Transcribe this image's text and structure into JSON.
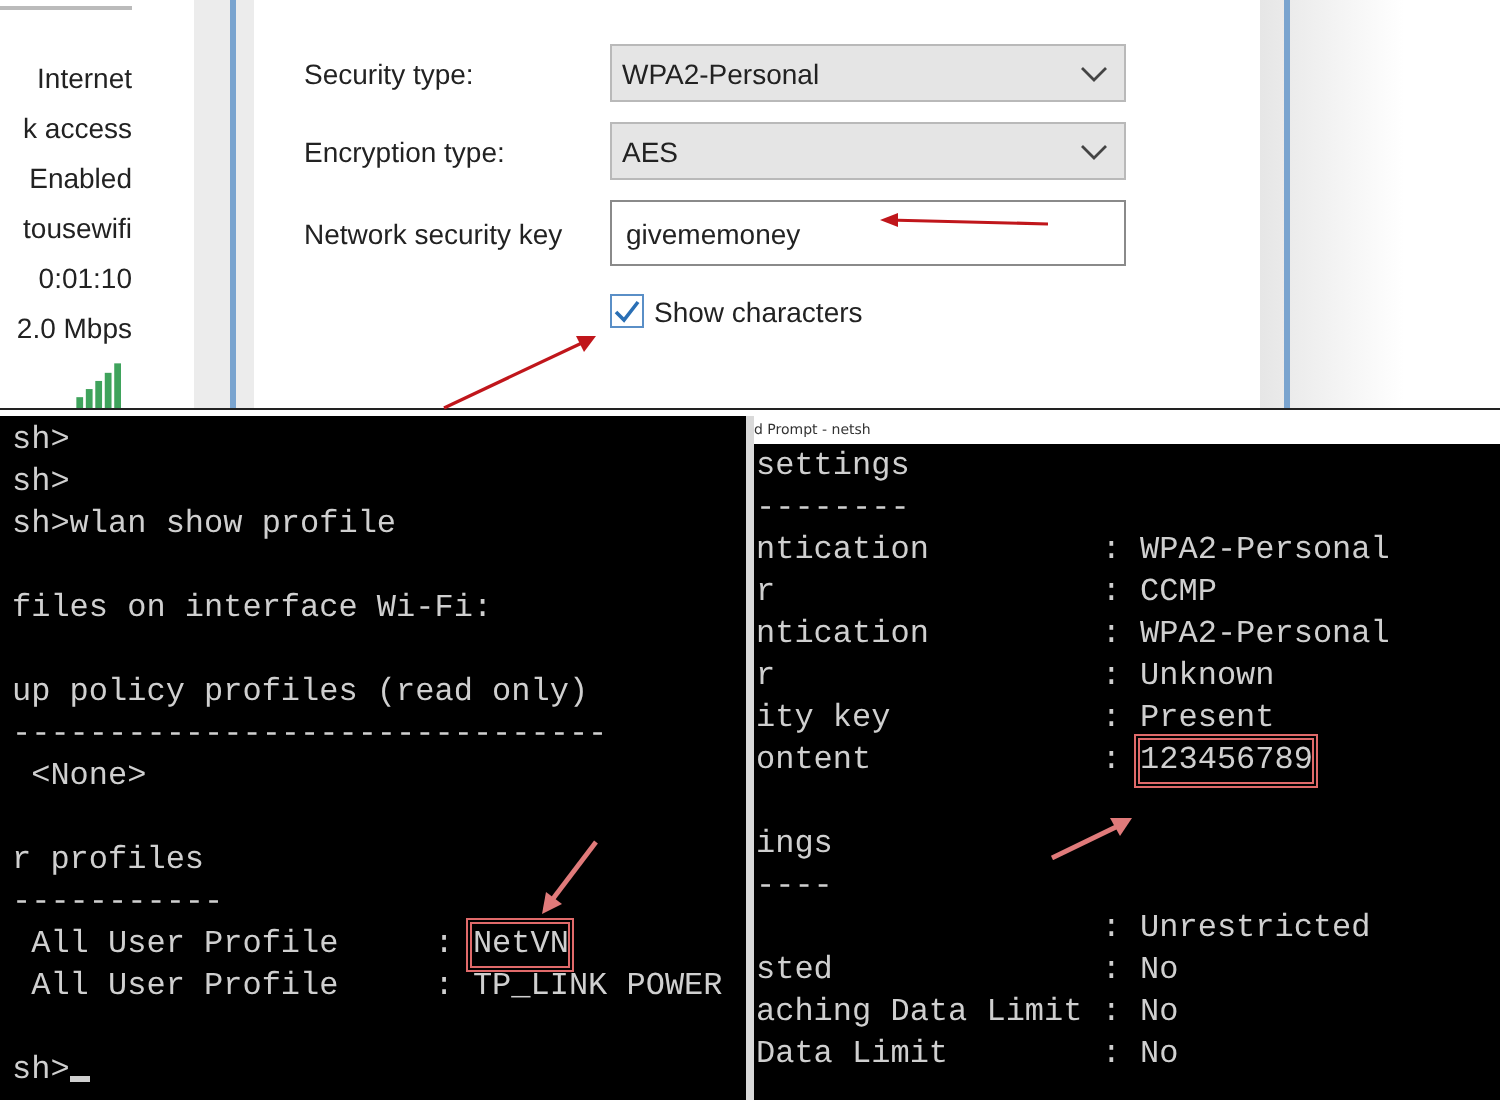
{
  "network_status": {
    "lines": [
      "Internet",
      "k access",
      "Enabled",
      "tousewifi",
      "0:01:10",
      "2.0 Mbps"
    ]
  },
  "security_dialog": {
    "fields": [
      {
        "kind": "dropdown",
        "label": "Security type:",
        "value": "WPA2-Personal"
      },
      {
        "kind": "dropdown",
        "label": "Encryption type:",
        "value": "AES"
      },
      {
        "kind": "text",
        "label": "Network security key",
        "value": "givememoney"
      }
    ],
    "show_characters": {
      "label": "Show characters",
      "checked": true
    }
  },
  "terminals": [
    {
      "lines": [
        {
          "kind": "plain",
          "text": "sh>"
        },
        {
          "kind": "plain",
          "text": "sh>"
        },
        {
          "kind": "plain",
          "text": "sh>wlan show profile"
        },
        {
          "kind": "blank"
        },
        {
          "kind": "plain",
          "text": "files on interface Wi-Fi:"
        },
        {
          "kind": "blank"
        },
        {
          "kind": "plain",
          "text": "up policy profiles (read only)"
        },
        {
          "kind": "plain",
          "text": "-------------------------------"
        },
        {
          "kind": "plain",
          "text": " <None>"
        },
        {
          "kind": "blank"
        },
        {
          "kind": "plain",
          "text": "r profiles"
        },
        {
          "kind": "plain",
          "text": "-----------"
        },
        {
          "kind": "boxed",
          "text": " All User Profile     : ",
          "value": "NetVN"
        },
        {
          "kind": "plain",
          "text": " All User Profile     : TP_LINK POWER"
        },
        {
          "kind": "blank"
        },
        {
          "kind": "plain",
          "text": "sh>"
        }
      ],
      "cursor": true
    },
    {
      "title": "d Prompt - netsh",
      "lines": [
        {
          "kind": "plain",
          "text": "settings"
        },
        {
          "kind": "plain",
          "text": "--------"
        },
        {
          "kind": "plain",
          "text": "ntication         : WPA2-Personal"
        },
        {
          "kind": "plain",
          "text": "r                 : CCMP"
        },
        {
          "kind": "plain",
          "text": "ntication         : WPA2-Personal"
        },
        {
          "kind": "plain",
          "text": "r                 : Unknown"
        },
        {
          "kind": "plain",
          "text": "ity key           : Present"
        },
        {
          "kind": "boxed",
          "text": "ontent            : ",
          "value": "123456789"
        },
        {
          "kind": "blank"
        },
        {
          "kind": "plain",
          "text": "ings"
        },
        {
          "kind": "plain",
          "text": "----"
        },
        {
          "kind": "plain",
          "text": "                  : Unrestricted"
        },
        {
          "kind": "plain",
          "text": "sted              : No"
        },
        {
          "kind": "plain",
          "text": "aching Data Limit : No"
        },
        {
          "kind": "plain",
          "text": "Data Limit        : No"
        }
      ],
      "cursor": false
    }
  ]
}
